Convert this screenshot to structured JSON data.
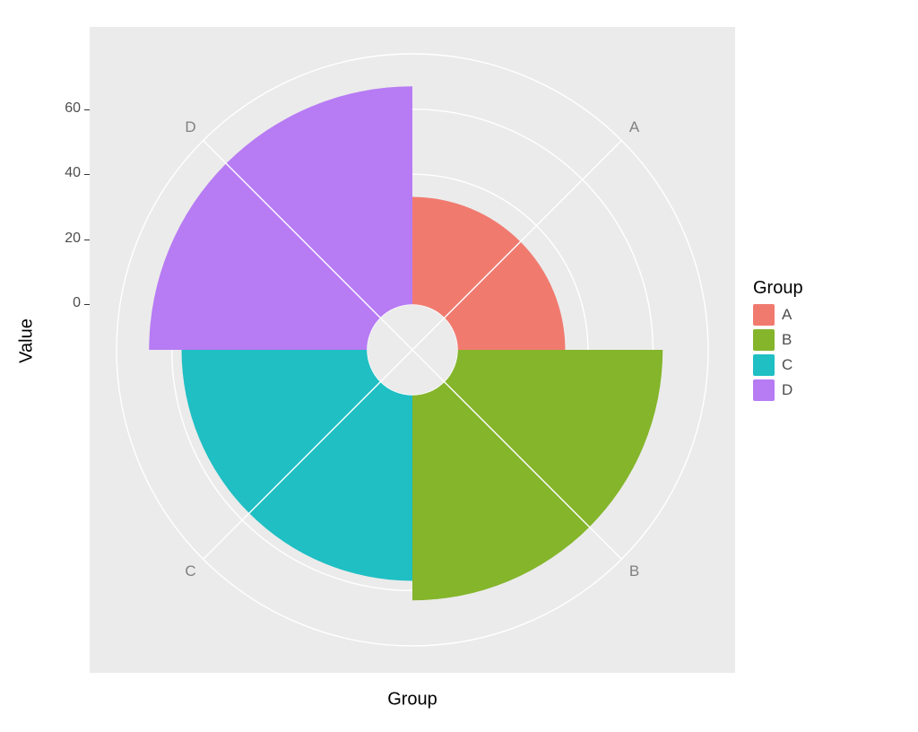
{
  "chart_data": {
    "type": "polar-bar",
    "categories": [
      "A",
      "B",
      "C",
      "D"
    ],
    "values": [
      33,
      63,
      57,
      67
    ],
    "series": [
      {
        "name": "A",
        "value": 33,
        "color": "#f17a6f"
      },
      {
        "name": "B",
        "value": 63,
        "color": "#84b52b"
      },
      {
        "name": "C",
        "value": 57,
        "color": "#1fbfc3"
      },
      {
        "name": "D",
        "value": 67,
        "color": "#b77bf4"
      }
    ],
    "xlabel": "Group",
    "ylabel": "Value",
    "y_ticks": [
      0,
      20,
      40,
      60
    ],
    "rlim": [
      -14,
      77
    ],
    "grid_circles": [
      -14,
      0,
      20,
      40,
      60,
      77
    ]
  },
  "legend": {
    "title": "Group",
    "items": [
      {
        "label": "A",
        "color": "#f17a6f"
      },
      {
        "label": "B",
        "color": "#84b52b"
      },
      {
        "label": "C",
        "color": "#1fbfc3"
      },
      {
        "label": "D",
        "color": "#b77bf4"
      }
    ]
  },
  "category_label_style": {
    "color": "#808080",
    "font_size": 17
  }
}
